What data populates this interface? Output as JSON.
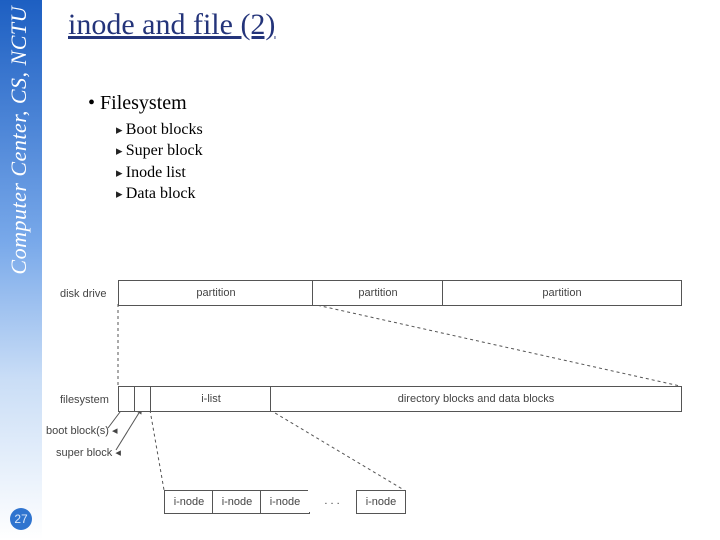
{
  "sidebar": {
    "org": "Computer Center, CS, NCTU"
  },
  "slide": {
    "number": "27",
    "title": "inode and file (2)"
  },
  "bullets": {
    "heading": "Filesystem",
    "items": [
      "Boot blocks",
      "Super block",
      "Inode list",
      "Data block"
    ]
  },
  "diagram": {
    "disk_label": "disk drive",
    "partition": "partition",
    "fs_label": "filesystem",
    "ilist": "i-list",
    "dbdb": "directory blocks and data blocks",
    "bootblock": "boot block(s)",
    "superblock": "super block",
    "inode": "i-node",
    "dots": ". . ."
  },
  "chart_data": {
    "type": "diagram",
    "disk_drive": {
      "partitions": 3
    },
    "filesystem_layout": [
      "boot block(s)",
      "super block",
      "i-list",
      "directory blocks and data blocks"
    ],
    "ilist_contents": [
      "i-node",
      "i-node",
      "i-node",
      "...",
      "i-node"
    ]
  }
}
